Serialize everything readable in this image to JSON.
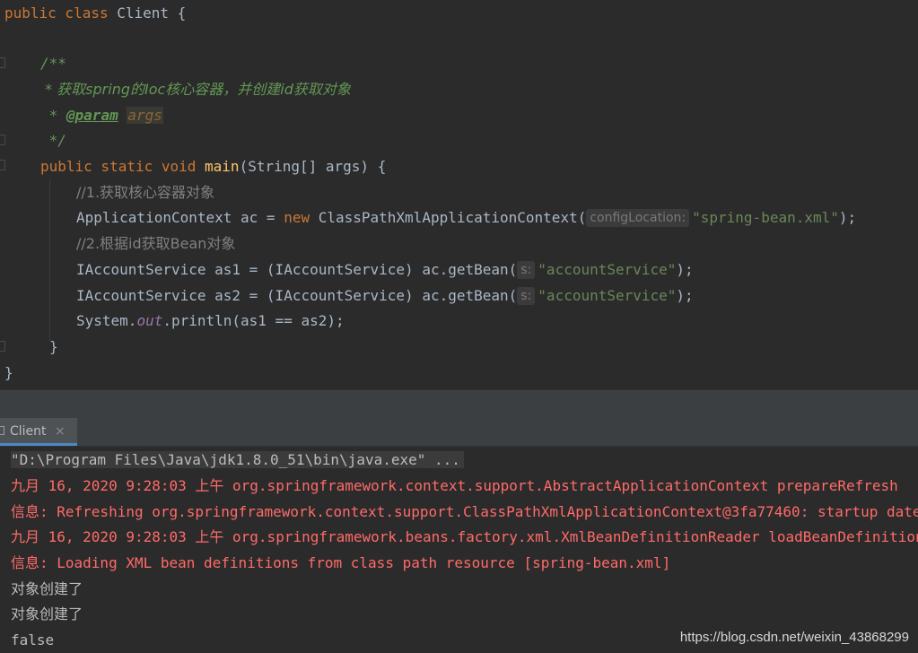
{
  "editor": {
    "line1": {
      "kw": "public class ",
      "name": "Client",
      "rest": " {"
    },
    "line2": {
      "text": "/**"
    },
    "line3": {
      "text": " * 获取spring的Ioc核心容器，并创建id获取对象"
    },
    "line4": {
      "star": " * ",
      "tag": "@param",
      "space": " ",
      "arg": "args"
    },
    "line5": {
      "text": " */"
    },
    "line6": {
      "kw": "public static void ",
      "fn": "main",
      "rest": "(String[] args) {"
    },
    "line7": {
      "text": "//1.获取核心容器对象"
    },
    "line8": {
      "pre": "ApplicationContext ac = ",
      "kw": "new ",
      "cls": "ClassPathXmlApplicationContext(",
      "hint": "configLocation:",
      "str": "\"spring-bean.xml\"",
      "end": ");"
    },
    "line9": {
      "text": "//2.根据id获取Bean对象"
    },
    "line10": {
      "pre": "IAccountService as1 = (IAccountService) ac.getBean(",
      "hint": "s:",
      "str": "\"accountService\"",
      "end": ");"
    },
    "line11": {
      "pre": "IAccountService as2 = (IAccountService) ac.getBean(",
      "hint": "s:",
      "str": "\"accountService\"",
      "end": ");"
    },
    "line12": {
      "a": "System.",
      "field": "out",
      "b": ".println(as1 == as2);"
    },
    "line13": {
      "text": "}"
    },
    "line14": {
      "text": "}"
    }
  },
  "run_panel": {
    "tab_label": "Client",
    "close_glyph": "×"
  },
  "console": {
    "command": "\"D:\\Program Files\\Java\\jdk1.8.0_51\\bin\\java.exe\" ...",
    "log1": "九月 16, 2020 9:28:03 上午 org.springframework.context.support.AbstractApplicationContext prepareRefresh",
    "log2": "信息: Refreshing org.springframework.context.support.ClassPathXmlApplicationContext@3fa77460: startup date",
    "log3": "九月 16, 2020 9:28:03 上午 org.springframework.beans.factory.xml.XmlBeanDefinitionReader loadBeanDefinitions",
    "log4": "信息: Loading XML bean definitions from class path resource [spring-bean.xml]",
    "out1": "对象创建了",
    "out2": "对象创建了",
    "out3": "false"
  },
  "watermark": "https://blog.csdn.net/weixin_43868299",
  "colors": {
    "editor_bg": "#2b2b2b",
    "keyword": "#cc7832",
    "comment": "#629755",
    "string": "#6a8759",
    "method": "#ffc66d",
    "error_text": "#ff6b68",
    "tab_underline": "#4a88c7"
  }
}
